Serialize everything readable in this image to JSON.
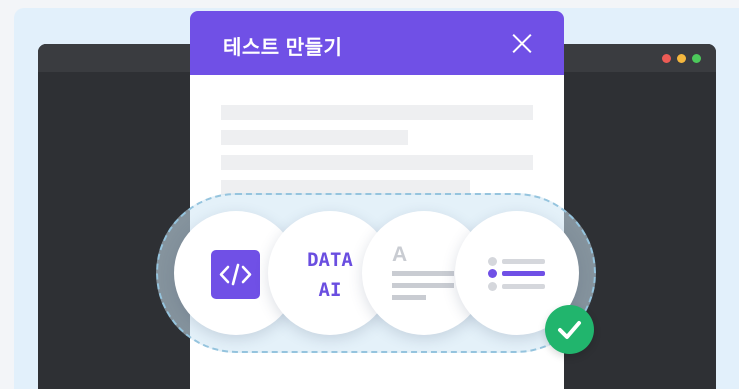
{
  "dialog": {
    "title": "테스트 만들기"
  },
  "options": [
    {
      "id": "code",
      "icon": "code-icon"
    },
    {
      "id": "data-ai",
      "line1": "DATA",
      "line2": "AI"
    },
    {
      "id": "text",
      "icon": "text-lines-icon",
      "letter": "A"
    },
    {
      "id": "multiple-choice",
      "icon": "list-icon"
    }
  ],
  "status": {
    "icon": "check-icon"
  },
  "colors": {
    "header": "#7050e6",
    "accent": "#7050e6",
    "selection_border": "#95c4de",
    "check": "#21b56d",
    "window_dots": [
      "#ec5b55",
      "#f4b73e",
      "#4cc95b"
    ]
  }
}
